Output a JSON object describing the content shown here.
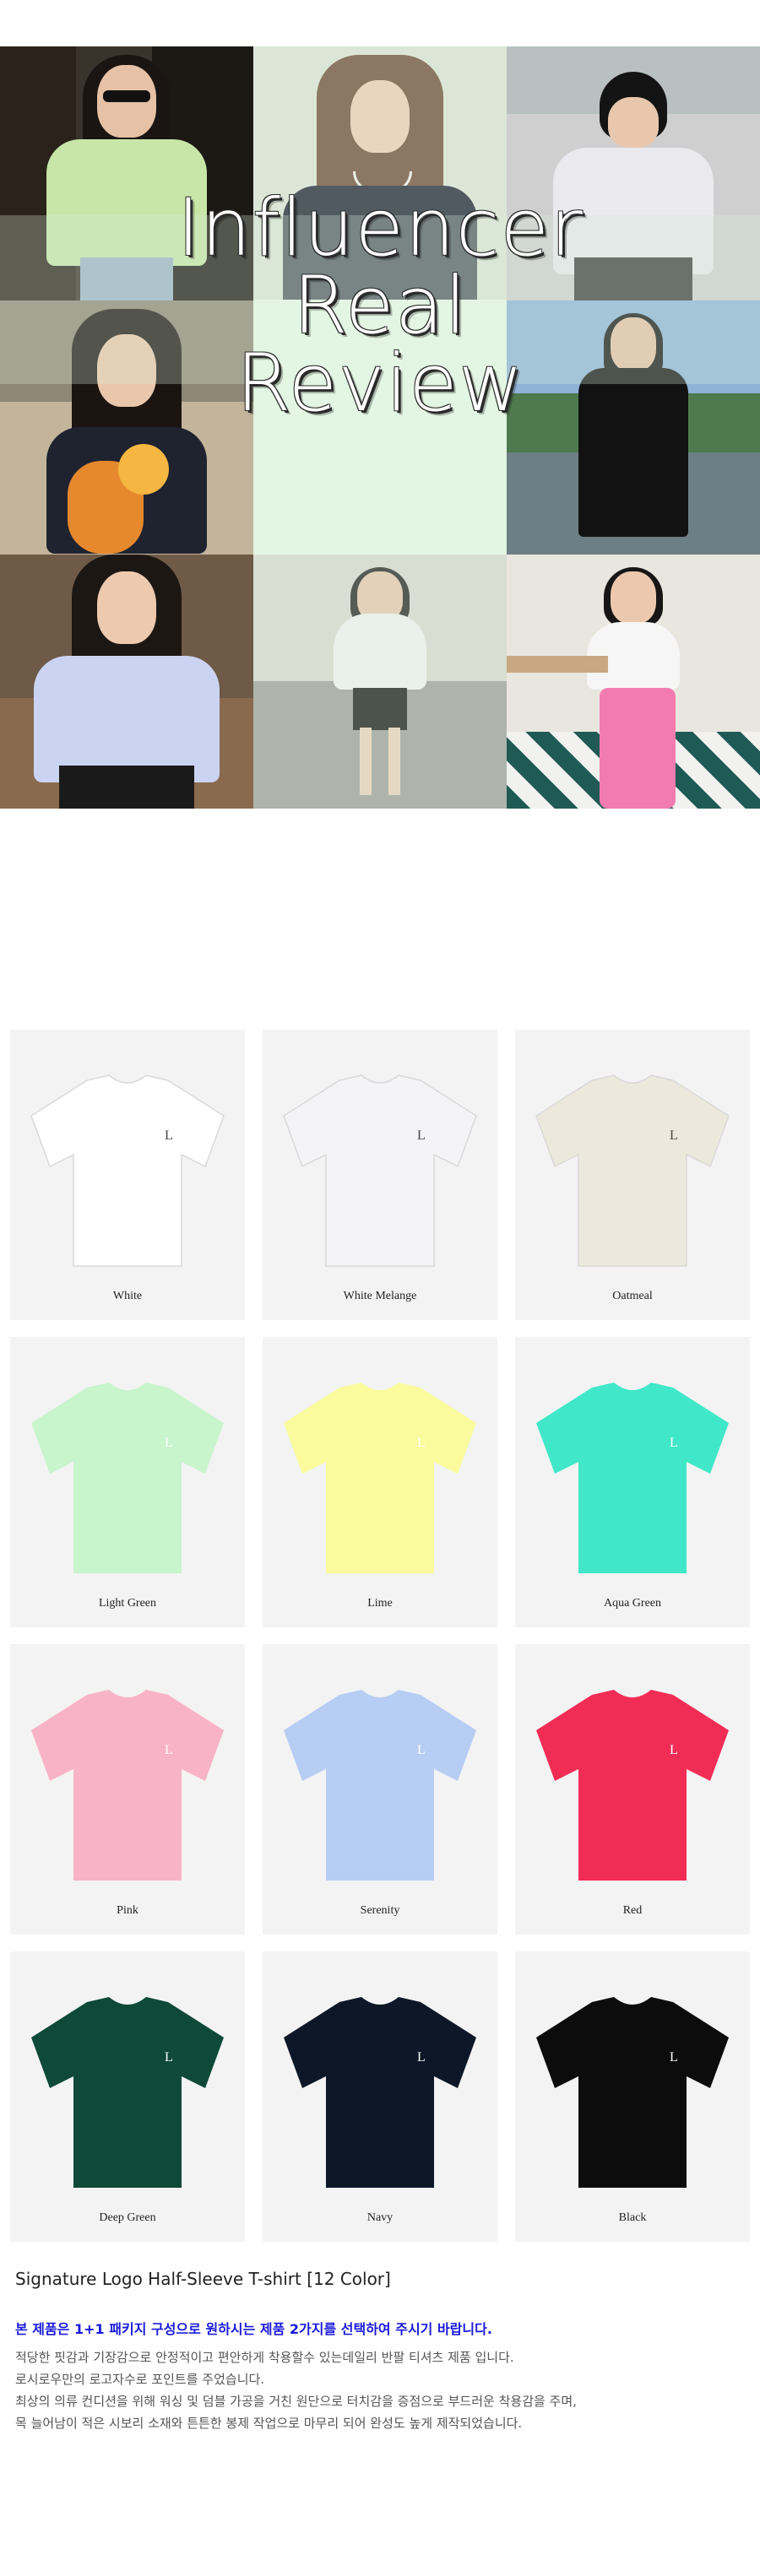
{
  "hero": {
    "title_lines": [
      "Influencer",
      "Real",
      "Review"
    ]
  },
  "products": [
    {
      "name": "White",
      "color": "#ffffff"
    },
    {
      "name": "White Melange",
      "color": "#f4f4f6"
    },
    {
      "name": "Oatmeal",
      "color": "#ece9dc"
    },
    {
      "name": "Light Green",
      "color": "#c8f5cc"
    },
    {
      "name": "Lime",
      "color": "#f9fb9c"
    },
    {
      "name": "Aqua Green",
      "color": "#40e7c8"
    },
    {
      "name": "Pink",
      "color": "#f9b3c6"
    },
    {
      "name": "Serenity",
      "color": "#b7cdf4"
    },
    {
      "name": "Red",
      "color": "#f22d55"
    },
    {
      "name": "Deep Green",
      "color": "#0e4a37"
    },
    {
      "name": "Navy",
      "color": "#0d1727"
    },
    {
      "name": "Black",
      "color": "#0c0c0c"
    }
  ],
  "description": {
    "title": "Signature Logo Half-Sleeve T-shirt [12 Color]",
    "notice": "본 제품은 1+1 패키지 구성으로 원하시는 제품 2가지를 선택하여 주시기 바랍니다.",
    "lines": [
      "적당한 핏감과 기장감으로 안정적이고 편안하게 착용할수 있는데일리 반팔 티셔츠 제품 입니다.",
      "로시로우만의 로고자수로 포인트를 주었습니다.",
      "최상의 의류 컨디션을 위해 워싱 및 덤블 가공을 거친 원단으로 터치감을 증점으로 부드러운 착용감을 주며,",
      "목 늘어남이 적은 시보리 소재와 튼튼한 봉제 작업으로 마무리 되어 완성도 높게 제작되었습니다."
    ]
  }
}
